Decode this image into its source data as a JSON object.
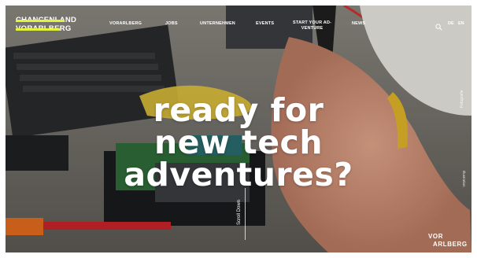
{
  "logo": {
    "line1": "CHANCENLAND",
    "line2": "VORARLBERG"
  },
  "nav": {
    "items": [
      {
        "label": "VORARLBERG"
      },
      {
        "label": "JOBS"
      },
      {
        "label": "UNTERNEHMEN"
      },
      {
        "label": "EVENTS"
      },
      {
        "label": "START YOUR AD-",
        "label2": "VENTURE"
      },
      {
        "label": "NEWS"
      }
    ]
  },
  "lang": {
    "de": "DE",
    "en": "EN"
  },
  "hero": {
    "line1": "ready for",
    "line2": "new tech",
    "line3": "adventures?"
  },
  "scroll": {
    "label": "Scroll Down"
  },
  "side": {
    "label": "Fotografie",
    "label2": "Illustration"
  },
  "brand": {
    "line1": "VOR",
    "line2": "ARLBERG"
  },
  "colors": {
    "accent": "#e5f23a",
    "text": "#ffffff"
  },
  "icons": {
    "search": "search-icon"
  }
}
